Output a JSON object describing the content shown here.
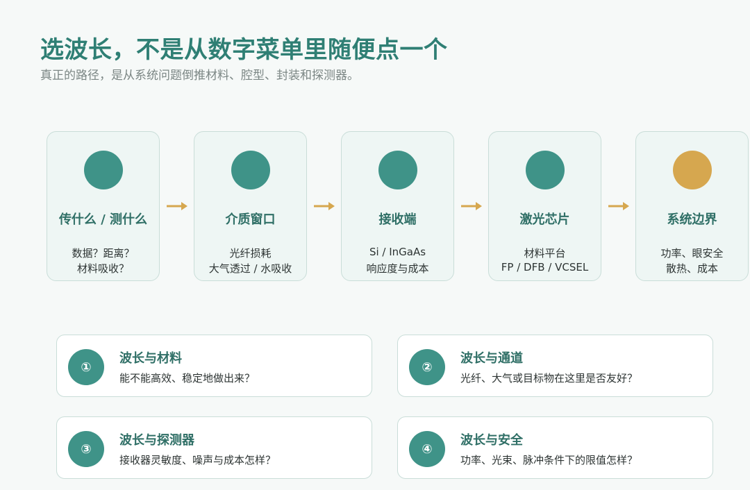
{
  "header": {
    "title": "选波长，不是从数字菜单里随便点一个",
    "subtitle": "真正的路径，是从系统问题倒推材料、腔型、封装和探测器。"
  },
  "colors": {
    "accent": "#3f9388",
    "highlight": "#d6a74f",
    "title": "#2f7f74",
    "arrow": "#d6a74f"
  },
  "steps": [
    {
      "title": "传什么 / 测什么",
      "line1": "数据？距离？",
      "line2": "材料吸收？",
      "dot": "teal"
    },
    {
      "title": "介质窗口",
      "line1": "光纤损耗",
      "line2": "大气透过 / 水吸收",
      "dot": "teal"
    },
    {
      "title": "接收端",
      "line1": "Si / InGaAs",
      "line2": "响应度与成本",
      "dot": "teal"
    },
    {
      "title": "激光芯片",
      "line1": "材料平台",
      "line2": "FP / DFB / VCSEL",
      "dot": "teal"
    },
    {
      "title": "系统边界",
      "line1": "功率、眼安全",
      "line2": "散热、成本",
      "dot": "gold"
    }
  ],
  "cards": [
    {
      "badge": "①",
      "title": "波长与材料",
      "text": "能不能高效、稳定地做出来？"
    },
    {
      "badge": "②",
      "title": "波长与通道",
      "text": "光纤、大气或目标物在这里是否友好？"
    },
    {
      "badge": "③",
      "title": "波长与探测器",
      "text": "接收器灵敏度、噪声与成本怎样？"
    },
    {
      "badge": "④",
      "title": "波长与安全",
      "text": "功率、光束、脉冲条件下的限值怎样？"
    }
  ]
}
